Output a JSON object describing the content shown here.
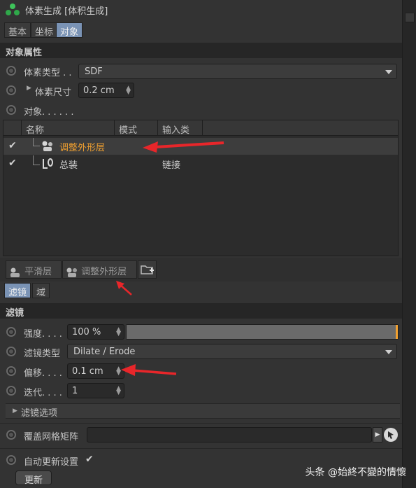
{
  "window": {
    "title": "体素生成 [体积生成]"
  },
  "tabs": [
    {
      "label": "基本",
      "active": false
    },
    {
      "label": "坐标",
      "active": false
    },
    {
      "label": "对象",
      "active": true
    }
  ],
  "object_properties": {
    "section_title": "对象属性",
    "voxel_type_label": "体素类型 . .",
    "voxel_type_value": "SDF",
    "voxel_size_label": "体素尺寸",
    "voxel_size_value": "0.2 cm",
    "objects_label": "对象. . . . . ."
  },
  "object_table": {
    "columns": [
      "名称",
      "模式",
      "输入类型"
    ],
    "rows": [
      {
        "checked": "✔",
        "name": "调整外形层",
        "mode": "",
        "input_type": "",
        "highlighted": true
      },
      {
        "checked": "✔",
        "name": "总装",
        "mode": "",
        "input_type": "链接",
        "highlighted": false
      }
    ]
  },
  "layer_tabs": [
    {
      "label": "平滑层"
    },
    {
      "label": "调整外形层"
    }
  ],
  "filter_tabs": [
    {
      "label": "滤镜",
      "active": true
    },
    {
      "label": "域",
      "active": false
    }
  ],
  "filter": {
    "section_title": "滤镜",
    "strength_label": "强度. . . .",
    "strength_value": "100 %",
    "strength_fraction": 1.0,
    "filter_type_label": "滤镜类型",
    "filter_type_value": "Dilate / Erode",
    "offset_label": "偏移. . . .",
    "offset_value": "0.1 cm",
    "iterations_label": "迭代. . . .",
    "iterations_value": "1",
    "filter_options_label": "滤镜选项"
  },
  "overwrite_matrix": {
    "label": "覆盖网格矩阵",
    "value": ""
  },
  "auto_update": {
    "label": "自动更新设置",
    "checked": "✔"
  },
  "update_button": {
    "label": "更新"
  },
  "watermark": {
    "text": "头条 @始終不變的情懷"
  },
  "colors": {
    "accent_orange": "#f0a030",
    "annotation_red": "#e8262a",
    "active_tab": "#7a93b5"
  }
}
